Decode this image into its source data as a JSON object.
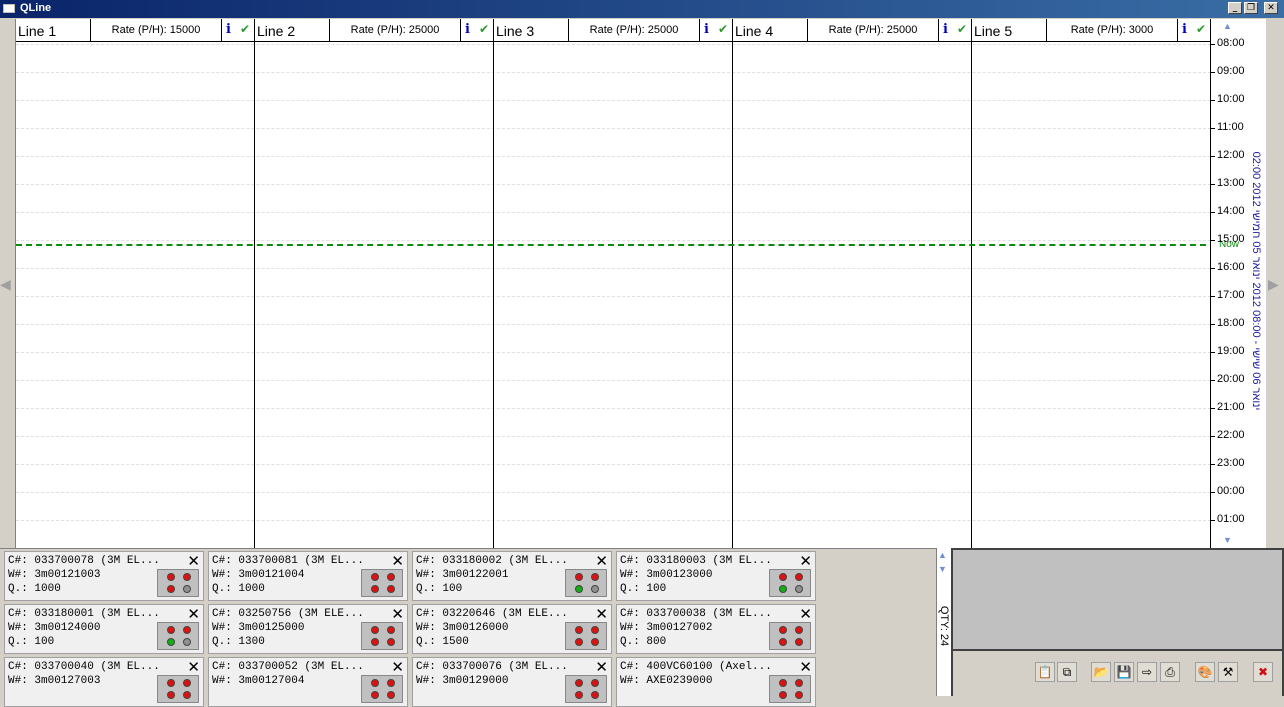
{
  "window": {
    "title": "QLine"
  },
  "lines": [
    {
      "name": "Line 1",
      "rate": "Rate (P/H): 15000"
    },
    {
      "name": "Line 2",
      "rate": "Rate (P/H): 25000"
    },
    {
      "name": "Line 3",
      "rate": "Rate (P/H): 25000"
    },
    {
      "name": "Line 4",
      "rate": "Rate (P/H): 25000"
    },
    {
      "name": "Line 5",
      "rate": "Rate (P/H): 3000"
    }
  ],
  "line_icons": {
    "info": "i",
    "ok": "✔"
  },
  "hours": [
    "08:00",
    "09:00",
    "10:00",
    "11:00",
    "12:00",
    "13:00",
    "14:00",
    "15:00",
    "16:00",
    "17:00",
    "18:00",
    "19:00",
    "20:00",
    "21:00",
    "22:00",
    "23:00",
    "00:00",
    "01:00"
  ],
  "now_label": "Now",
  "date_range": "02:00 2012 ינואר 06 שישי - 08:00 2012 ינואר 05 חמישי",
  "cards": [
    {
      "c": "C#: 033700078 (3M EL...",
      "w": "W#: 3m00121003",
      "q": "Q.: 1000",
      "lights": [
        "red",
        "red",
        "red",
        "gray"
      ]
    },
    {
      "c": "C#: 033700081 (3M EL...",
      "w": "W#: 3m00121004",
      "q": "Q.: 1000",
      "lights": [
        "red",
        "red",
        "red",
        "red"
      ]
    },
    {
      "c": "C#: 033180002 (3M EL...",
      "w": "W#: 3m00122001",
      "q": "Q.: 100",
      "lights": [
        "red",
        "red",
        "green",
        "gray"
      ]
    },
    {
      "c": "C#: 033180003 (3M EL...",
      "w": "W#: 3m00123000",
      "q": "Q.: 100",
      "lights": [
        "red",
        "red",
        "green",
        "gray"
      ]
    },
    {
      "c": "C#: 033180001 (3M EL...",
      "w": "W#: 3m00124000",
      "q": "Q.: 100",
      "lights": [
        "red",
        "red",
        "green",
        "gray"
      ]
    },
    {
      "c": "C#: 03250756 (3M ELE...",
      "w": "W#: 3m00125000",
      "q": "Q.: 1300",
      "lights": [
        "red",
        "red",
        "red",
        "red"
      ]
    },
    {
      "c": "C#: 03220646 (3M ELE...",
      "w": "W#: 3m00126000",
      "q": "Q.: 1500",
      "lights": [
        "red",
        "red",
        "red",
        "red"
      ]
    },
    {
      "c": "C#: 033700038 (3M EL...",
      "w": "W#: 3m00127002",
      "q": "Q.: 800",
      "lights": [
        "red",
        "red",
        "red",
        "red"
      ]
    },
    {
      "c": "C#: 033700040 (3M EL...",
      "w": "W#: 3m00127003",
      "q": "",
      "lights": [
        "red",
        "red",
        "red",
        "red"
      ]
    },
    {
      "c": "C#: 033700052 (3M EL...",
      "w": "W#: 3m00127004",
      "q": "",
      "lights": [
        "red",
        "red",
        "red",
        "red"
      ]
    },
    {
      "c": "C#: 033700076 (3M EL...",
      "w": "W#: 3m00129000",
      "q": "",
      "lights": [
        "red",
        "red",
        "red",
        "red"
      ]
    },
    {
      "c": "C#: 400VC60100 (Axel...",
      "w": "W#: AXE0239000",
      "q": "",
      "lights": [
        "red",
        "red",
        "red",
        "red"
      ]
    }
  ],
  "card_close": "✕",
  "qty_label": "QTY: 24",
  "toolbar": [
    {
      "name": "clipboard-icon",
      "glyph": "📋"
    },
    {
      "name": "copy-icon",
      "glyph": "⧉"
    },
    {
      "name": "open-folder-icon",
      "glyph": "📂"
    },
    {
      "name": "save-icon",
      "glyph": "💾"
    },
    {
      "name": "export-icon",
      "glyph": "⇨"
    },
    {
      "name": "print-icon",
      "glyph": "⎙"
    },
    {
      "name": "palette-icon",
      "glyph": "🎨"
    },
    {
      "name": "tools-icon",
      "glyph": "⚒"
    },
    {
      "name": "exit-icon",
      "glyph": "✖"
    }
  ],
  "colors": {
    "red": "#e01010",
    "green": "#10b010",
    "gray": "#909090",
    "now": "#0a8a0a"
  }
}
